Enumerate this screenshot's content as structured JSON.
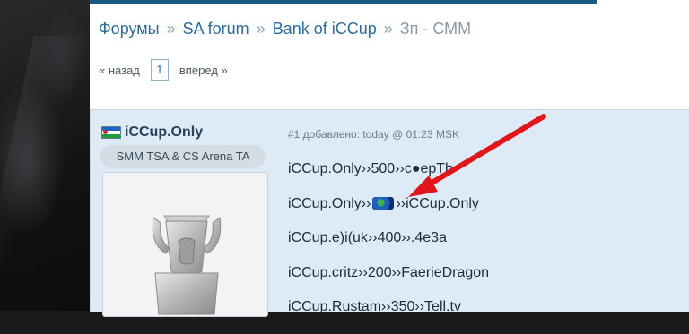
{
  "breadcrumb": {
    "items": [
      "Форумы",
      "SA forum",
      "Bank of iCCup"
    ],
    "separator": "»",
    "current": "Зп - СММ"
  },
  "pager": {
    "prev": "« назад",
    "page": "1",
    "next": "вперед »"
  },
  "post": {
    "author": "iCCup.Only",
    "rank": "SMM TSA & CS Arena TA",
    "meta": "#1 добавлено: today @ 01:23 MSK",
    "lines": [
      {
        "text": "iCCup.Only››500››c●epTb"
      },
      {
        "before": "iCCup.Only››",
        "icon": "globe-icon",
        "after": "››iCCup.Only"
      },
      {
        "text": "iCCup.e)i(uk››400››.4e3a"
      },
      {
        "text": "iCCup.critz››200››FaerieDragon"
      },
      {
        "text": "iCCup.Rustam››350››Tell.tv"
      }
    ]
  },
  "colors": {
    "link": "#2f6c96",
    "post_bg": "#deeaf5",
    "arrow": "#e0161b"
  }
}
